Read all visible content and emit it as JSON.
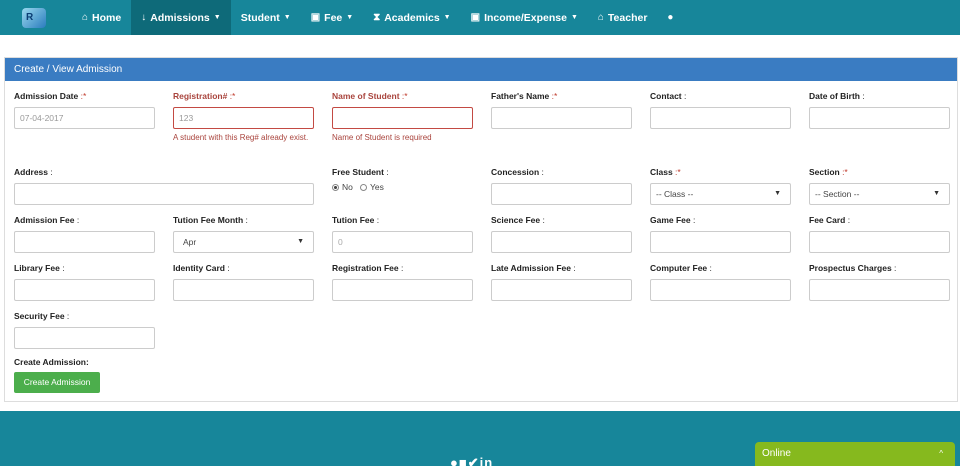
{
  "nav": {
    "items": [
      {
        "icon": "home-icon",
        "glyph": "⌂",
        "label": "Home",
        "caret": ""
      },
      {
        "icon": "download-icon",
        "glyph": "🡓",
        "label": "Admissions",
        "caret": "▾"
      },
      {
        "icon": "",
        "glyph": "",
        "label": "Student",
        "caret": "▾"
      },
      {
        "icon": "money-icon",
        "glyph": "▣",
        "label": "Fee",
        "caret": "▾"
      },
      {
        "icon": "hourglass-icon",
        "glyph": "⧗",
        "label": "Academics",
        "caret": "▾"
      },
      {
        "icon": "money-icon",
        "glyph": "▣",
        "label": "Income/Expense",
        "caret": "▾"
      },
      {
        "icon": "graduation-cap-icon",
        "glyph": "🎓",
        "label": "Teacher",
        "caret": ""
      },
      {
        "icon": "user-icon",
        "glyph": "👤",
        "label": "",
        "caret": ""
      }
    ],
    "active_index": 1
  },
  "panel": {
    "title": "Create / View Admission"
  },
  "form": {
    "admission_date": {
      "label": "Admission Date",
      "value": "07-04-2017"
    },
    "registration": {
      "label": "Registration#",
      "value": "123",
      "error": "A student with this Reg# already exist."
    },
    "student_name": {
      "label": "Name of Student",
      "value": "",
      "error": "Name of Student is required"
    },
    "father_name": {
      "label": "Father's Name",
      "value": ""
    },
    "contact": {
      "label": "Contact",
      "value": ""
    },
    "dob": {
      "label": "Date of Birth",
      "value": ""
    },
    "address": {
      "label": "Address",
      "value": ""
    },
    "free_student": {
      "label": "Free Student",
      "opt_no": "No",
      "opt_yes": "Yes",
      "selected": "No"
    },
    "concession": {
      "label": "Concession",
      "value": ""
    },
    "class": {
      "label": "Class",
      "selected": "-- Class --"
    },
    "section": {
      "label": "Section",
      "selected": "-- Section --"
    },
    "admission_fee": {
      "label": "Admission Fee",
      "value": ""
    },
    "tution_fee_month": {
      "label": "Tution Fee Month",
      "selected": "Apr"
    },
    "tution_fee": {
      "label": "Tution Fee",
      "value": "0"
    },
    "science_fee": {
      "label": "Science Fee",
      "value": ""
    },
    "game_fee": {
      "label": "Game Fee",
      "value": ""
    },
    "fee_card": {
      "label": "Fee Card",
      "value": ""
    },
    "library_fee": {
      "label": "Library Fee",
      "value": ""
    },
    "identity_card": {
      "label": "Identity Card",
      "value": ""
    },
    "registration_fee": {
      "label": "Registration Fee",
      "value": ""
    },
    "late_admission_fee": {
      "label": "Late Admission Fee",
      "value": ""
    },
    "computer_fee": {
      "label": "Computer Fee",
      "value": ""
    },
    "prospectus_charges": {
      "label": "Prospectus Charges",
      "value": ""
    },
    "security_fee": {
      "label": "Security Fee",
      "value": ""
    },
    "create_label": "Create Admission:",
    "create_button": "Create Admission"
  },
  "footer": {
    "social": [
      "github-icon",
      "facebook-icon",
      "twitter-icon",
      "linkedin-icon"
    ],
    "social_text": "in"
  },
  "chat": {
    "label": "Online",
    "chevron": "^"
  },
  "colors": {
    "navbar": "#17869a",
    "panel_heading": "#3a7cc2",
    "button": "#4cae4c",
    "error": "#a9443d",
    "online": "#86b91e"
  }
}
